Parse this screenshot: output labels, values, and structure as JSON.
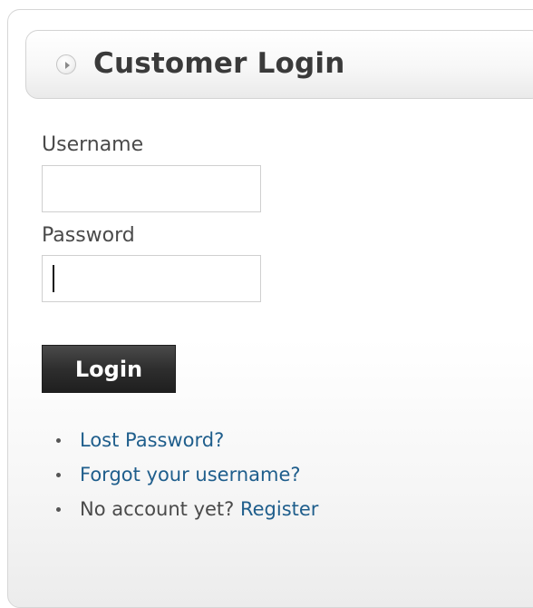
{
  "module": {
    "title": "Customer Login",
    "header_icon": "arrow-right-circle-icon"
  },
  "form": {
    "username_label": "Username",
    "username_value": "",
    "password_label": "Password",
    "password_value": "",
    "login_button": "Login"
  },
  "links": {
    "lost_password": "Lost Password?",
    "forgot_username": "Forgot your username?",
    "no_account_text": "No account yet?",
    "register": "Register"
  },
  "colors": {
    "link": "#1f5e8c",
    "button": "#2e2e2e",
    "text": "#4a4a4a"
  }
}
